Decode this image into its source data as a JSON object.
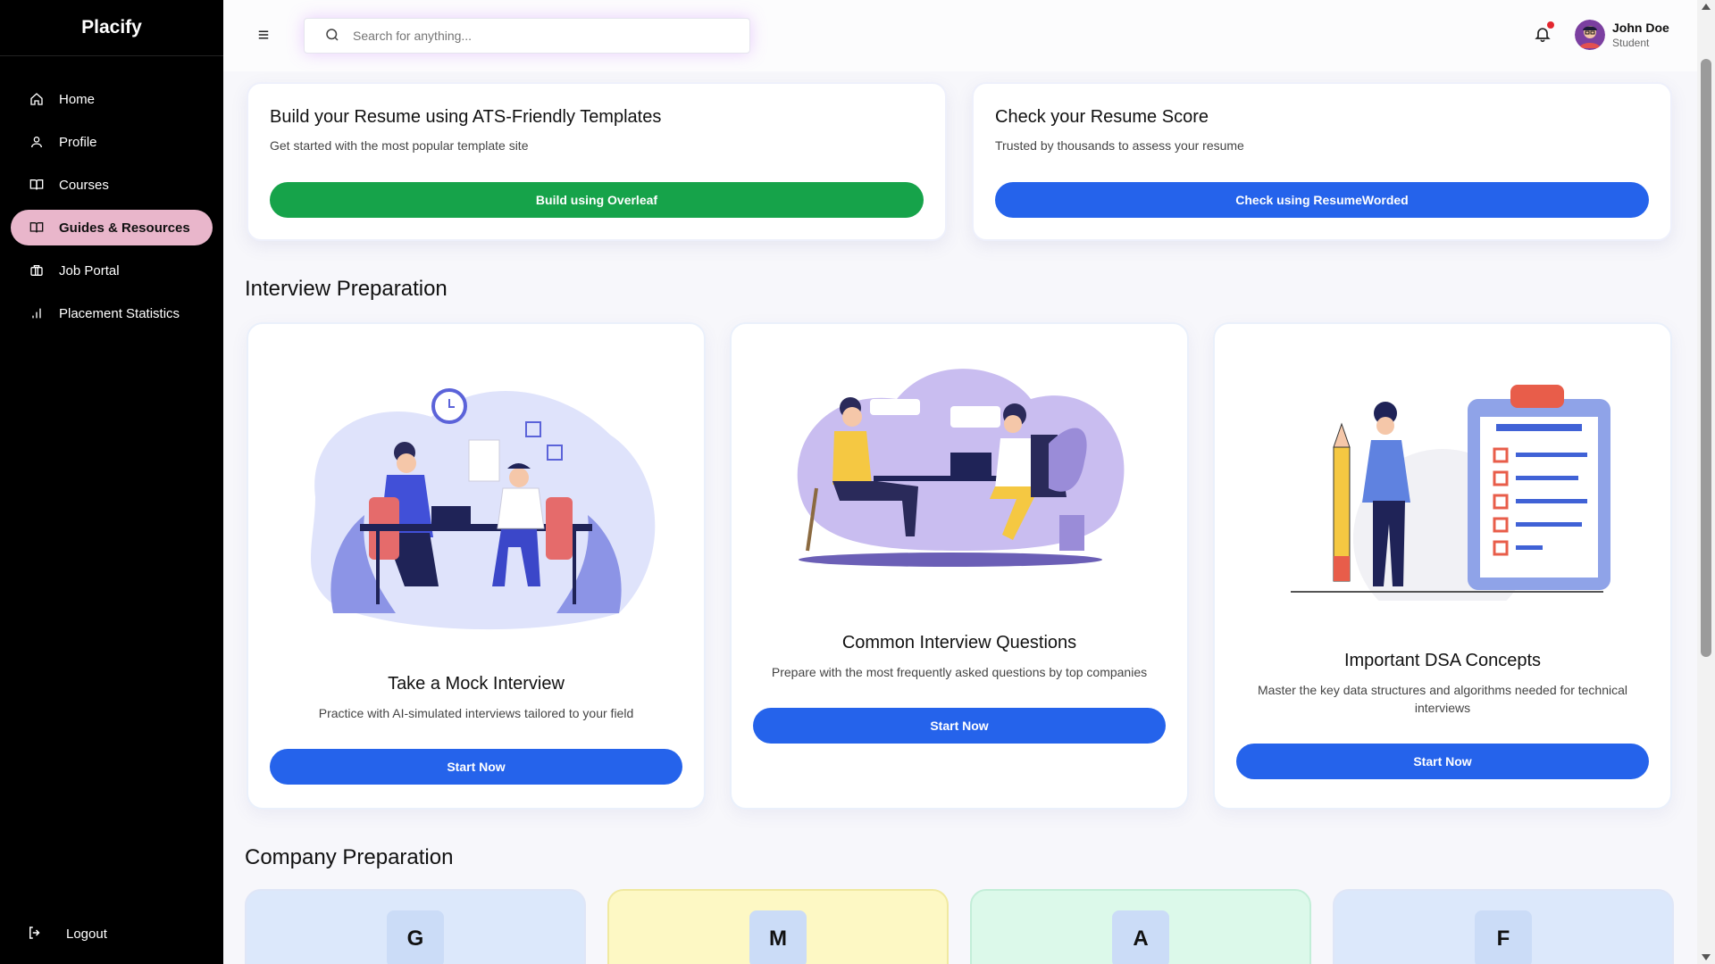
{
  "sidebar": {
    "brand": "Placify",
    "items": [
      {
        "label": "Home",
        "icon": "home-icon"
      },
      {
        "label": "Profile",
        "icon": "user-icon"
      },
      {
        "label": "Courses",
        "icon": "book-icon"
      },
      {
        "label": "Guides & Resources",
        "icon": "book-open-icon",
        "active": true
      },
      {
        "label": "Job Portal",
        "icon": "briefcase-icon"
      },
      {
        "label": "Placement Statistics",
        "icon": "bar-chart-icon"
      }
    ],
    "logout_label": "Logout"
  },
  "header": {
    "search_placeholder": "Search for anything...",
    "user_name": "John Doe",
    "user_role": "Student",
    "notification_dot_color": "#e3262f"
  },
  "resume": {
    "build": {
      "title": "Build your Resume using ATS-Friendly Templates",
      "subtitle": "Get started with the most popular template site",
      "button": "Build using Overleaf"
    },
    "score": {
      "title": "Check your Resume Score",
      "subtitle": "Trusted by thousands to assess your resume",
      "button": "Check using ResumeWorded"
    }
  },
  "interview": {
    "section_title": "Interview Preparation",
    "cards": [
      {
        "title": "Take a Mock Interview",
        "desc": "Practice with AI-simulated interviews tailored to your field",
        "button": "Start Now"
      },
      {
        "title": "Common Interview Questions",
        "desc": "Prepare with the most frequently asked questions by top companies",
        "button": "Start Now"
      },
      {
        "title": "Important DSA Concepts",
        "desc": "Master the key data structures and algorithms needed for technical interviews",
        "button": "Start Now"
      }
    ]
  },
  "company": {
    "section_title": "Company Preparation",
    "cards": [
      {
        "letter": "G",
        "bg": "#dce8fb"
      },
      {
        "letter": "M",
        "bg": "#fdf8c4"
      },
      {
        "letter": "A",
        "bg": "#dcf9ea"
      },
      {
        "letter": "F",
        "bg": "#dce8fb"
      }
    ]
  },
  "colors": {
    "accent_blue": "#2563eb",
    "accent_green": "#16a34a",
    "active_nav": "#e9b6cb"
  }
}
